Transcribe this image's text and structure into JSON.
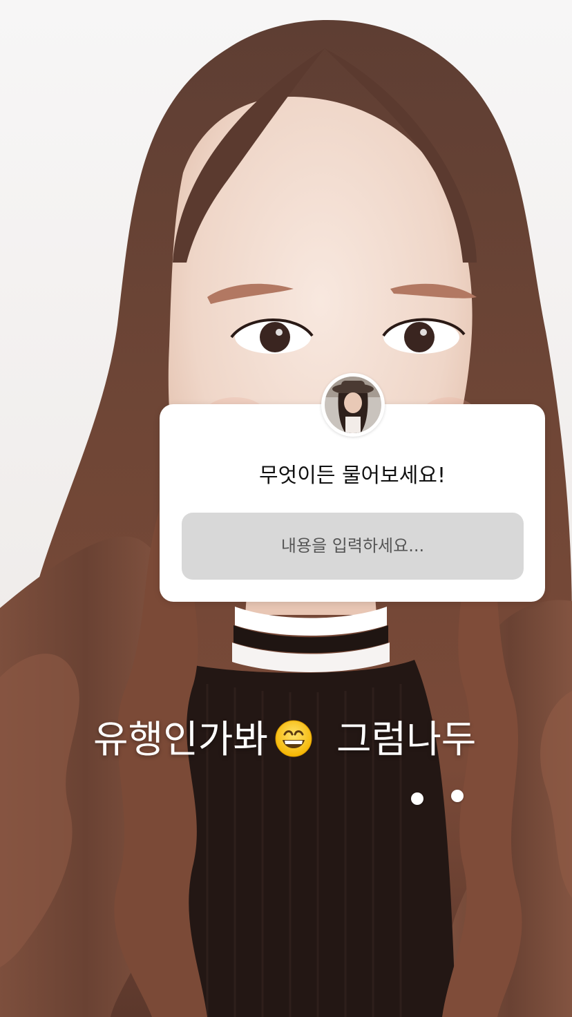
{
  "sticker": {
    "title": "무엇이든 물어보세요!",
    "input_placeholder": "내용을 입력하세요..."
  },
  "caption": {
    "left_text": "유행인가봐",
    "emoji": "grinning-face-emoji",
    "right_text": "그럼나두"
  },
  "decor": {
    "dots": 2
  },
  "colors": {
    "hair": "#6b4334",
    "skin": "#ecd2c4",
    "background": "#f4f2f1",
    "sweater": "#231714",
    "sticker_bg": "#ffffff",
    "input_bg": "#d8d8d8"
  }
}
